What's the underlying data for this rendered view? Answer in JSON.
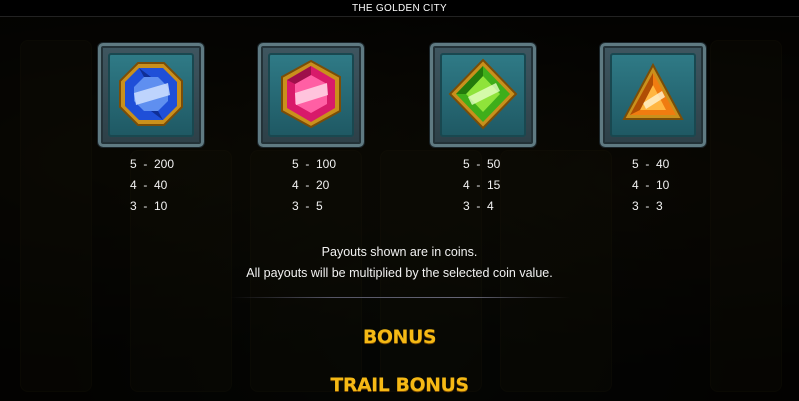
{
  "header": {
    "title": "THE GOLDEN CITY"
  },
  "symbols": [
    {
      "name": "blue-gem",
      "color": "#1f4fd8",
      "pays": [
        "5  -  200",
        "4  -  40",
        "3  -  10"
      ]
    },
    {
      "name": "pink-gem",
      "color": "#e0206f",
      "pays": [
        "5  -  100",
        "4  -  20",
        "3  -  5"
      ]
    },
    {
      "name": "green-gem",
      "color": "#3fbf1f",
      "pays": [
        "5  -  50",
        "4  -  15",
        "3  -  4"
      ]
    },
    {
      "name": "orange-gem",
      "color": "#f08a10",
      "pays": [
        "5  -  40",
        "4  -  10",
        "3  -  3"
      ]
    }
  ],
  "info": {
    "line1": "Payouts shown are in coins.",
    "line2": "All payouts will be multiplied by the selected coin value."
  },
  "sections": {
    "bonus": "BONUS",
    "trail_bonus": "TRAIL BONUS"
  },
  "colors": {
    "heading": "#f5b915",
    "tile": "#2f7a86",
    "frame": "#5f7a82"
  }
}
